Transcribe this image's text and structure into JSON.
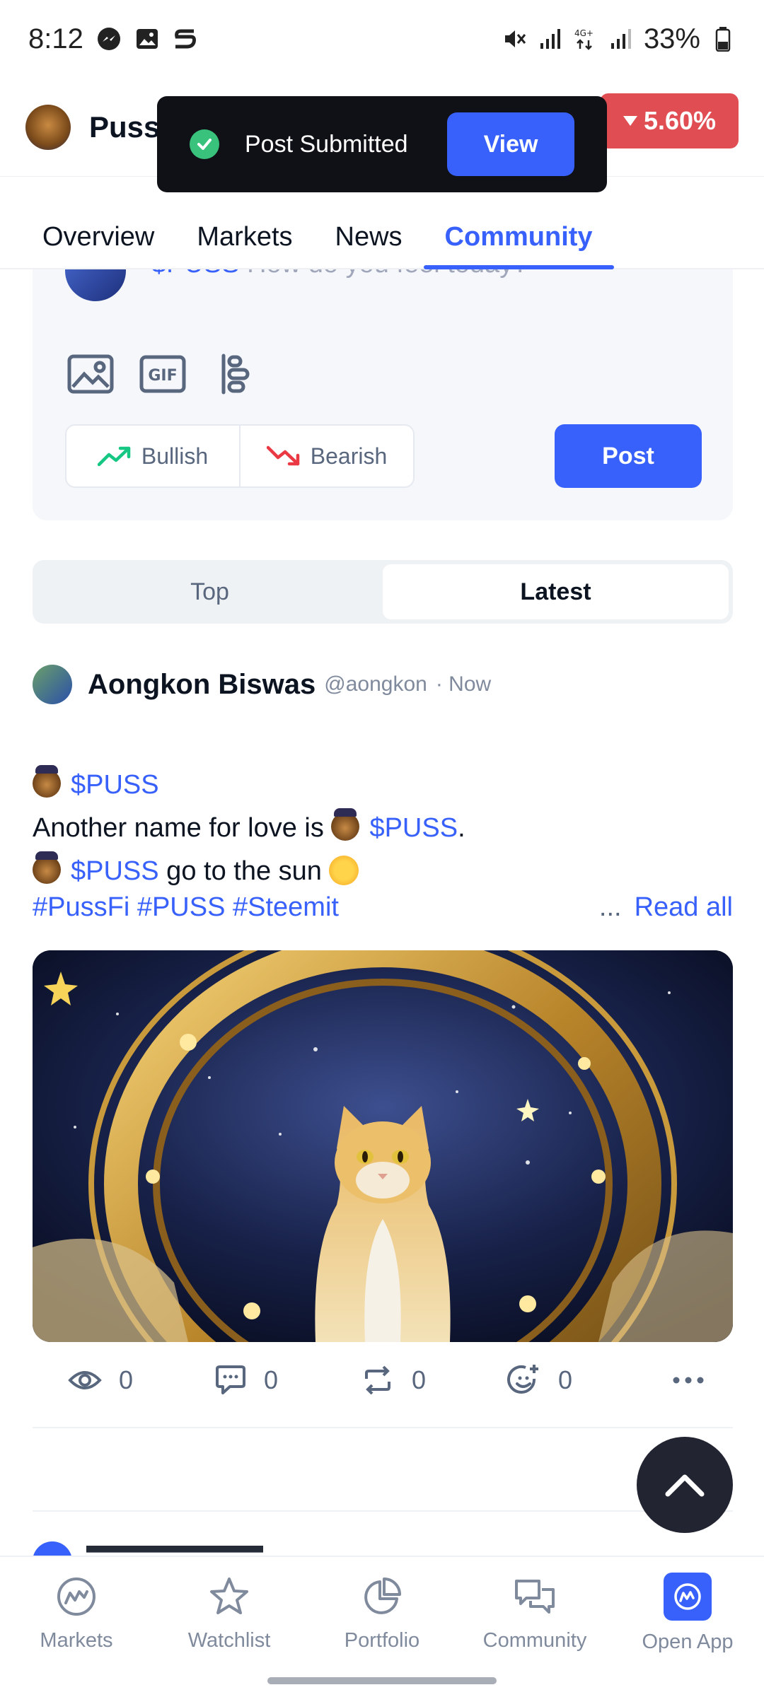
{
  "status_bar": {
    "time": "8:12",
    "battery": "33%"
  },
  "header": {
    "coin_name": "Puss",
    "change": "5.60%",
    "change_color": "#e04e54"
  },
  "toast": {
    "message": "Post Submitted",
    "action": "View"
  },
  "tabs": [
    {
      "label": "Overview"
    },
    {
      "label": "Markets"
    },
    {
      "label": "News"
    },
    {
      "label": "Community"
    }
  ],
  "active_tab": "Community",
  "composer": {
    "prompt_tag": "$PUSS",
    "prompt_text": " How do you feel today?",
    "bullish_label": "Bullish",
    "bearish_label": "Bearish",
    "post_label": "Post"
  },
  "feed_filter": {
    "options": [
      "Top",
      "Latest"
    ],
    "selected": "Latest"
  },
  "post": {
    "author": "Aongkon Biswas",
    "handle": "@aongkon",
    "time": "· Now",
    "lines": [
      {
        "tag": "$PUSS"
      },
      {
        "pre": "Another name for love is ",
        "tag": "$PUSS",
        "post": "."
      },
      {
        "tag": "$PUSS",
        "post": " go to the sun"
      }
    ],
    "hashtags": "#PussFi #PUSS #Steemit",
    "more": "...",
    "read_all": "Read all",
    "stats": {
      "views": "0",
      "comments": "0",
      "reposts": "0",
      "reactions": "0"
    }
  },
  "bottom_nav": [
    {
      "label": "Markets",
      "icon": "markets-icon"
    },
    {
      "label": "Watchlist",
      "icon": "star-icon"
    },
    {
      "label": "Portfolio",
      "icon": "pie-chart-icon"
    },
    {
      "label": "Community",
      "icon": "chat-bubbles-icon"
    },
    {
      "label": "Open App",
      "icon": "app-logo-icon"
    }
  ],
  "colors": {
    "accent": "#3861fb",
    "positive": "#16c784",
    "negative": "#ea3943"
  }
}
